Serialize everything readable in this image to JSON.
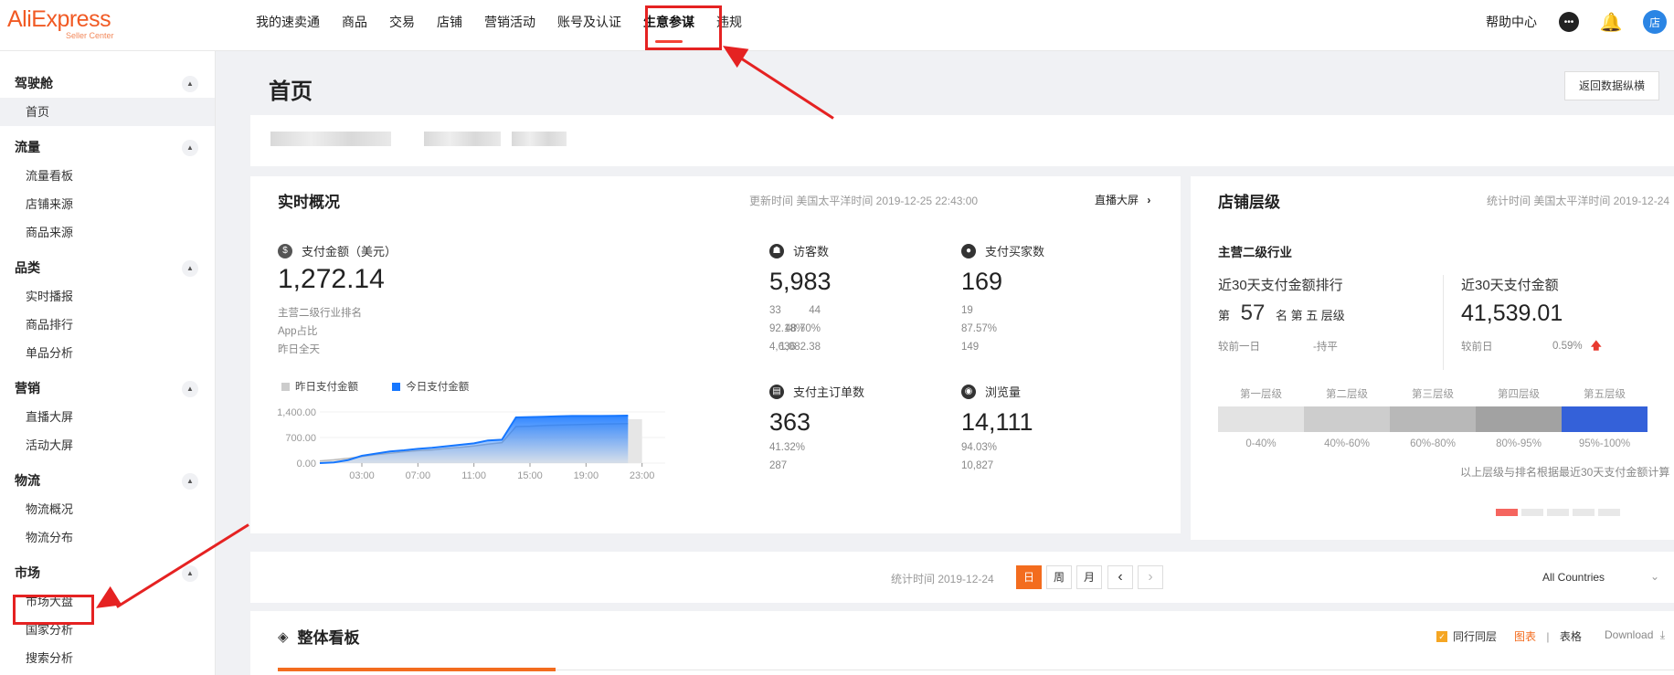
{
  "app": {
    "logo_text": "AliExpress",
    "logo_sub": "Seller Center"
  },
  "nav": {
    "items": [
      {
        "label": "我的速卖通"
      },
      {
        "label": "商品"
      },
      {
        "label": "交易"
      },
      {
        "label": "店铺"
      },
      {
        "label": "营销活动"
      },
      {
        "label": "账号及认证"
      },
      {
        "label": "生意参谋",
        "active": true
      },
      {
        "label": "违规"
      }
    ],
    "help": "帮助中心"
  },
  "sidebar": {
    "groups": [
      {
        "label": "驾驶舱",
        "items": [
          "首页"
        ]
      },
      {
        "label": "流量",
        "items": [
          "流量看板",
          "店铺来源",
          "商品来源"
        ]
      },
      {
        "label": "品类",
        "items": [
          "实时播报",
          "商品排行",
          "单品分析"
        ]
      },
      {
        "label": "营销",
        "items": [
          "直播大屏",
          "活动大屏"
        ]
      },
      {
        "label": "物流",
        "items": [
          "物流概况",
          "物流分布"
        ]
      },
      {
        "label": "市场",
        "items": [
          "市场大盘",
          "国家分析",
          "搜索分析"
        ]
      }
    ]
  },
  "page": {
    "title": "首页",
    "back_button": "返回数据纵横"
  },
  "realtime": {
    "title": "实时概况",
    "update_time": "更新时间 美国太平洋时间 2019-12-25 22:43:00",
    "live_link": "直播大屏",
    "payment": {
      "label": "支付金额（美元）",
      "value": "1,272.14",
      "rows": [
        {
          "k": "主营二级行业排名",
          "v": "44"
        },
        {
          "k": "App占比",
          "v": "48.70%"
        },
        {
          "k": "昨日全天",
          "v": "1,082.38"
        }
      ]
    },
    "visitors": {
      "label": "访客数",
      "value": "5,983",
      "rows": [
        "33",
        "92.18%",
        "4,636"
      ]
    },
    "buyers": {
      "label": "支付买家数",
      "value": "169",
      "rows": [
        "19",
        "87.57%",
        "149"
      ]
    },
    "orders": {
      "label": "支付主订单数",
      "value": "363",
      "rows": [
        "41.32%",
        "287"
      ]
    },
    "views": {
      "label": "浏览量",
      "value": "14,111",
      "rows": [
        "94.03%",
        "10,827"
      ]
    }
  },
  "chart_data": {
    "type": "area",
    "series": [
      {
        "name": "昨日支付金额",
        "color": "#cccccc"
      },
      {
        "name": "今日支付金额",
        "color": "#1677ff"
      }
    ],
    "yticks": [
      "1,400.00",
      "700.00",
      "0.00"
    ],
    "xticks": [
      "03:00",
      "07:00",
      "11:00",
      "15:00",
      "19:00",
      "23:00"
    ],
    "ylim": [
      0,
      1400
    ],
    "x": [
      0,
      1,
      2,
      3,
      4,
      5,
      6,
      7,
      8,
      9,
      10,
      11,
      12,
      13,
      14,
      15,
      16,
      17,
      18,
      19,
      20,
      21,
      22
    ],
    "today": [
      0,
      20,
      80,
      200,
      260,
      320,
      350,
      390,
      420,
      460,
      500,
      540,
      620,
      640,
      1250,
      1260,
      1270,
      1280,
      1290,
      1290,
      1290,
      1295,
      1300
    ],
    "yesterday": [
      60,
      90,
      130,
      180,
      230,
      270,
      310,
      340,
      360,
      400,
      430,
      470,
      520,
      560,
      1000,
      1010,
      1030,
      1040,
      1050,
      1060,
      1070,
      1075,
      1082
    ]
  },
  "shop_level": {
    "title": "店铺层级",
    "stat_time": "统计时间 美国太平洋时间 2019-12-24",
    "industry_label": "主营二级行业",
    "rank_title": "近30天支付金额排行",
    "rank_prefix": "第",
    "rank_value": "57",
    "rank_suffix": "名 第 五 层级",
    "rank_cmp_label": "较前一日",
    "rank_cmp_value": "-持平",
    "pay_title": "近30天支付金额",
    "pay_value": "41,539.01",
    "pay_cmp_label": "较前日",
    "pay_cmp_value": "0.59%",
    "levels": [
      {
        "name": "第一层级",
        "range": "0-40%",
        "color": "#e3e3e3"
      },
      {
        "name": "第二层级",
        "range": "40%-60%",
        "color": "#cdcdcd"
      },
      {
        "name": "第三层级",
        "range": "60%-80%",
        "color": "#b8b8b8"
      },
      {
        "name": "第四层级",
        "range": "80%-95%",
        "color": "#a2a2a2"
      },
      {
        "name": "第五层级",
        "range": "95%-100%",
        "color": "#3461d9"
      }
    ],
    "note": "以上层级与排名根据最近30天支付金额计算"
  },
  "filter": {
    "stat_time": "统计时间 2019-12-24",
    "buttons": [
      "日",
      "周",
      "月"
    ],
    "prev": "‹",
    "next": "›",
    "country": "All Countries"
  },
  "board": {
    "title": "整体看板",
    "peer_label": "同行同层",
    "view_chart": "图表",
    "view_table": "表格",
    "download": "Download"
  }
}
